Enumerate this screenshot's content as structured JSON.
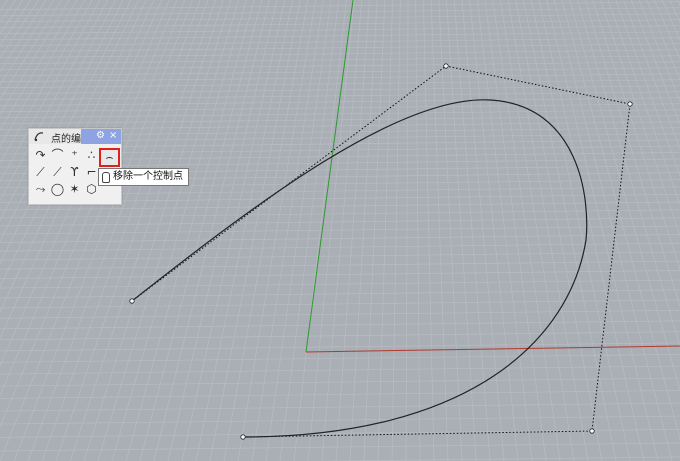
{
  "toolbar": {
    "title": "点的编",
    "gear_icon": "gear-icon",
    "close_label": "×"
  },
  "tools": [
    {
      "name": "insert-point-icon",
      "glyph": "↷"
    },
    {
      "name": "insert-kink-icon",
      "glyph": "⌒"
    },
    {
      "name": "add-point-icon",
      "glyph": "⁺"
    },
    {
      "name": "insert-edit-point-icon",
      "glyph": "∴"
    },
    {
      "name": "remove-control-point-icon",
      "glyph": "⌢"
    },
    {
      "name": "handlebar-icon",
      "glyph": "⟋"
    },
    {
      "name": "adjust-end-bulge-icon",
      "glyph": "⟋"
    },
    {
      "name": "adjust-blend-icon",
      "glyph": "ϒ"
    },
    {
      "name": "drag-control-point-icon",
      "glyph": "⌐"
    },
    {
      "name": "tangent-point-icon",
      "glyph": "⤳"
    },
    {
      "name": "lasso-icon",
      "glyph": "◯"
    },
    {
      "name": "color-points-icon",
      "glyph": "✶"
    },
    {
      "name": "box-edit-icon",
      "glyph": "⬡"
    }
  ],
  "tooltip": {
    "text": "移除一个控制点"
  },
  "colors": {
    "viewport_bg": "#a9afb5",
    "grid_line": "#b8bdc2",
    "x_axis": "#b03a2e",
    "y_axis": "#2e9a2e",
    "highlight": "#e0201d",
    "title_accent": "#8ea4e2"
  }
}
